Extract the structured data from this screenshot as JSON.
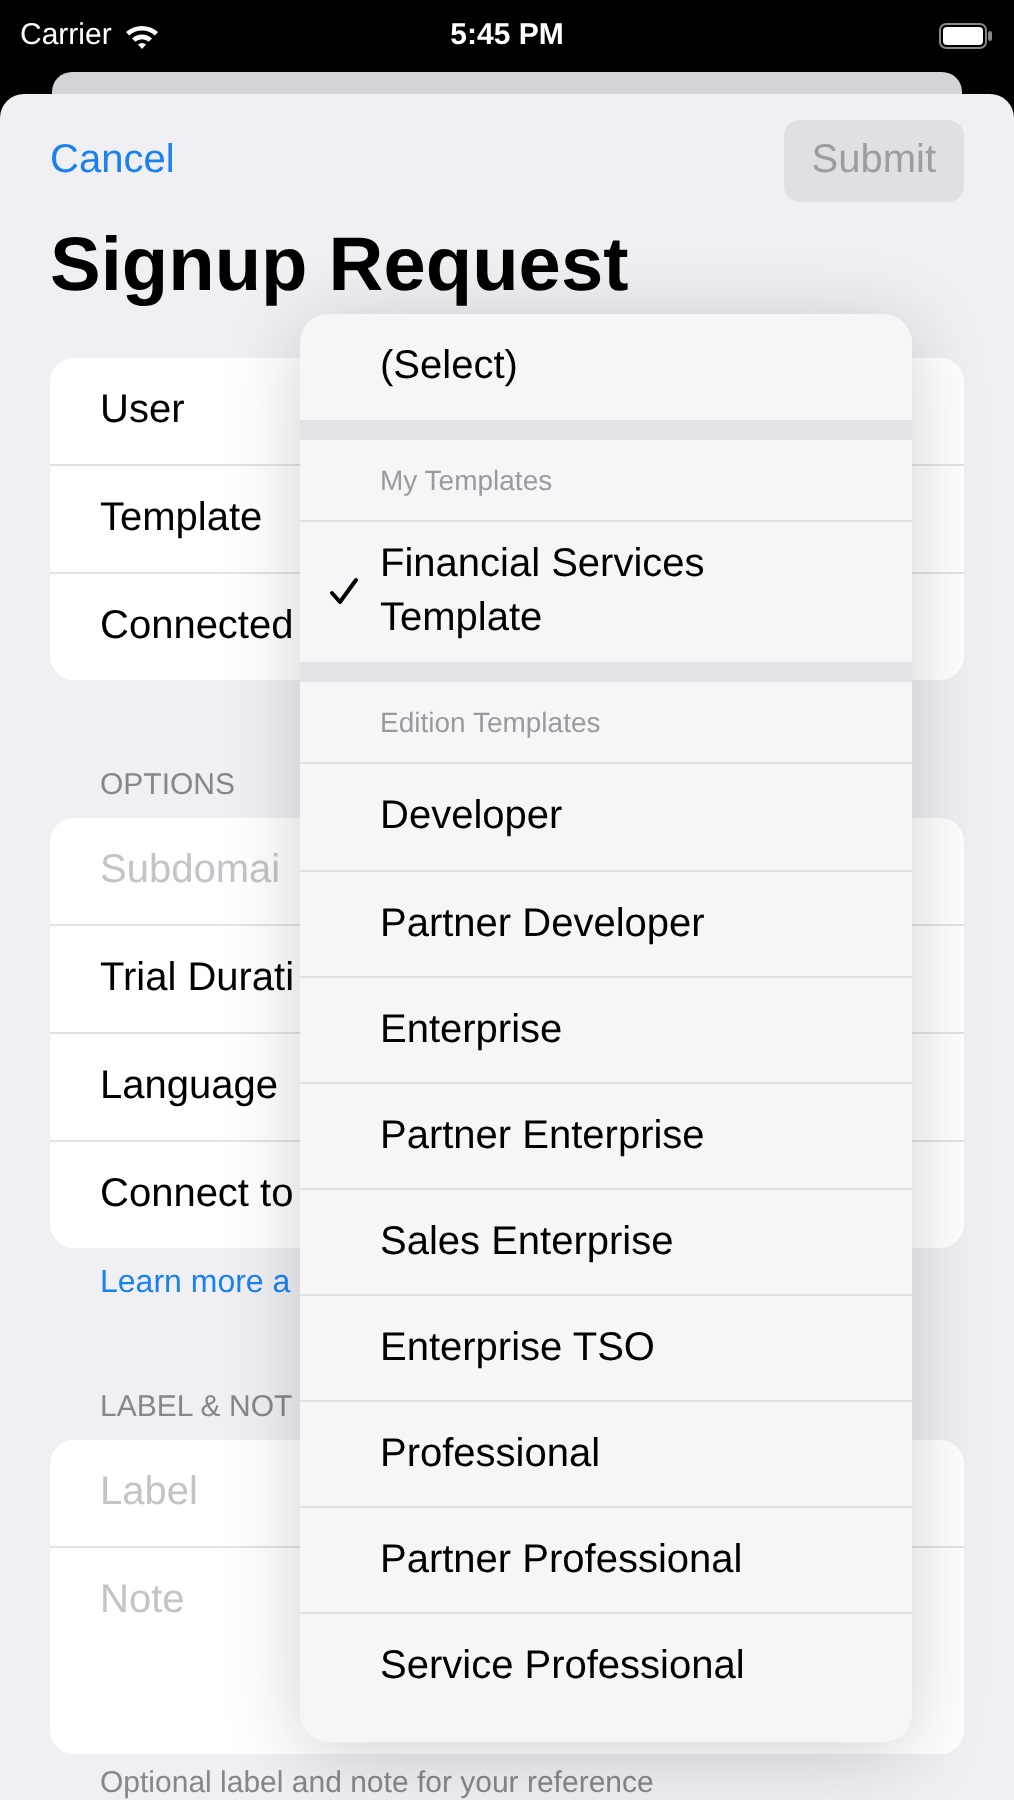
{
  "status_bar": {
    "carrier": "Carrier",
    "time": "5:45 PM"
  },
  "nav": {
    "cancel": "Cancel",
    "submit": {
      "label": "Submit",
      "disabled": true
    }
  },
  "title": "Signup Request",
  "groups": [
    {
      "rows": [
        {
          "label": "User",
          "kind": "label"
        },
        {
          "label": "Template",
          "kind": "label"
        },
        {
          "label": "Connected",
          "kind": "label"
        }
      ]
    },
    {
      "header": "OPTIONS",
      "rows": [
        {
          "label": "Subdomai",
          "kind": "placeholder"
        },
        {
          "label": "Trial Durati",
          "kind": "label"
        },
        {
          "label": "Language",
          "kind": "label"
        },
        {
          "label": "Connect to",
          "kind": "label"
        }
      ],
      "footer_link": "Learn more a"
    },
    {
      "header": "LABEL & NOT",
      "rows": [
        {
          "label": "Label",
          "kind": "placeholder"
        },
        {
          "label": "Note",
          "kind": "placeholder",
          "tall": true
        }
      ],
      "footer": "Optional label and note for your reference"
    }
  ],
  "menu": {
    "sections": [
      {
        "items": [
          {
            "label": "(Select)",
            "selected": false
          }
        ]
      },
      {
        "header": "My Templates",
        "items": [
          {
            "label": "Financial Services Template",
            "selected": true
          }
        ]
      },
      {
        "header": "Edition Templates",
        "items": [
          {
            "label": "Developer",
            "selected": false
          },
          {
            "label": "Partner Developer",
            "selected": false
          },
          {
            "label": "Enterprise",
            "selected": false
          },
          {
            "label": "Partner Enterprise",
            "selected": false
          },
          {
            "label": "Sales Enterprise",
            "selected": false
          },
          {
            "label": "Enterprise TSO",
            "selected": false
          },
          {
            "label": "Professional",
            "selected": false
          },
          {
            "label": "Partner Professional",
            "selected": false
          },
          {
            "label": "Service Professional",
            "selected": false
          }
        ]
      }
    ]
  }
}
